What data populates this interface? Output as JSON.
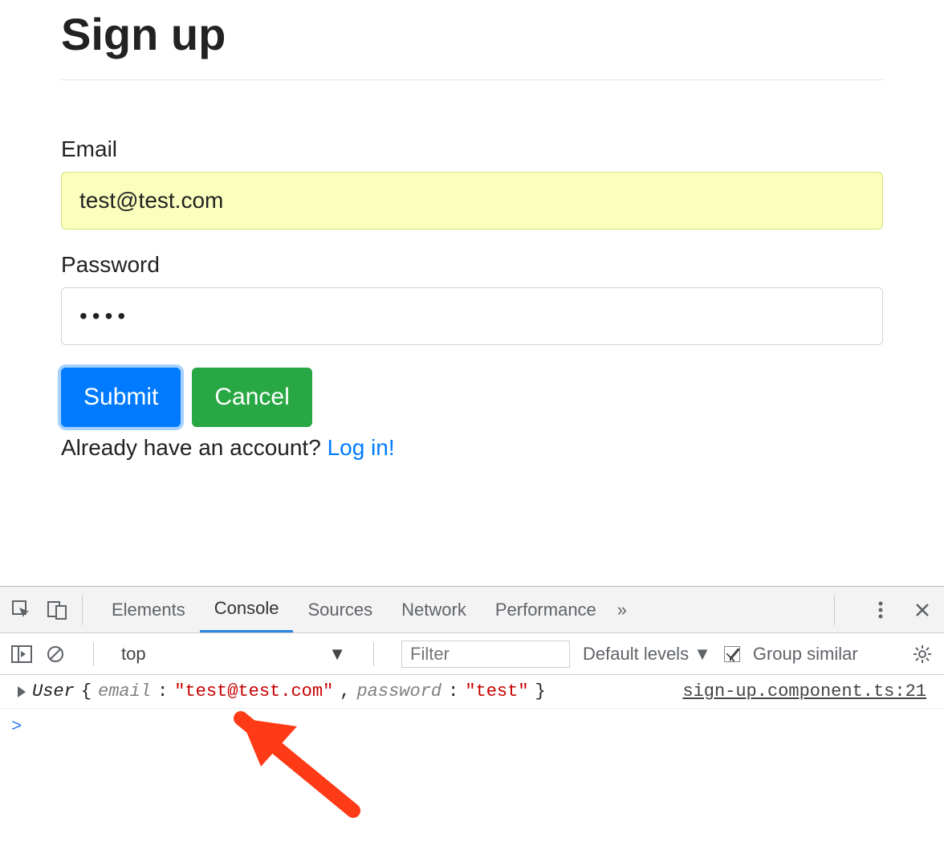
{
  "form": {
    "title": "Sign up",
    "email_label": "Email",
    "email_value": "test@test.com",
    "password_label": "Password",
    "password_masked": "••••",
    "submit_label": "Submit",
    "cancel_label": "Cancel",
    "already_text": "Already have an account?  ",
    "login_link": "Log in!"
  },
  "devtools": {
    "tabs": {
      "elements": "Elements",
      "console": "Console",
      "sources": "Sources",
      "network": "Network",
      "performance": "Performance",
      "more": "»"
    },
    "toolbar": {
      "context": "top",
      "filter_placeholder": "Filter",
      "levels": "Default levels",
      "group_similar": "Group similar"
    },
    "log": {
      "class_name": "User",
      "open_brace": " {",
      "key_email": "email",
      "val_email": "\"test@test.com\"",
      "comma": ", ",
      "key_password": "password",
      "val_password": "\"test\"",
      "close_brace": "}",
      "colon": ": ",
      "source": "sign-up.component.ts:21"
    },
    "prompt": ">"
  }
}
